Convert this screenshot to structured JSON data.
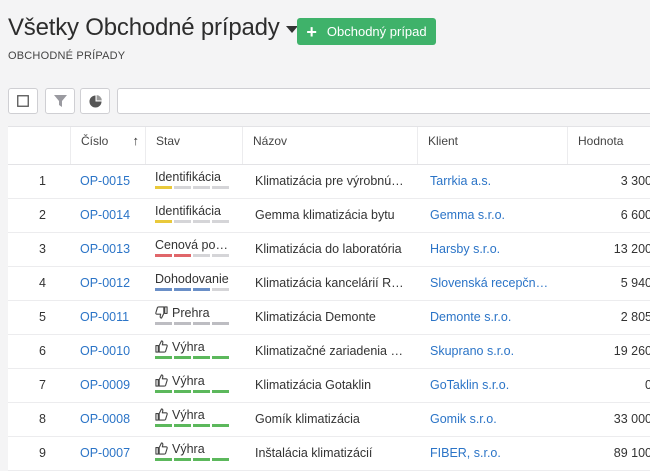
{
  "header": {
    "title": "Všetky Obchodné prípady",
    "subtitle": "OBCHODNÉ PRÍPADY",
    "new_button_label": "Obchodný prípad",
    "new_button_icon": "plus-icon"
  },
  "toolbar": {
    "checkbox_icon": "checkbox-icon",
    "filter_icon": "filter-icon",
    "chart_icon": "pie-chart-icon",
    "search_value": ""
  },
  "table": {
    "columns": [
      "Číslo",
      "Stav",
      "Názov",
      "Klient",
      "Hodnota"
    ],
    "sort_arrow": "↑",
    "rows": [
      {
        "n": "1",
        "id": "OP-0015",
        "stav": "Identifikácia",
        "stage_icon": "",
        "stage_progress": 1,
        "stage_color": "#e9c93b",
        "nazov": "Klimatizácia pre výrobnú halu",
        "klient": "Tarrkia a.s.",
        "hodnota": "3 300"
      },
      {
        "n": "2",
        "id": "OP-0014",
        "stav": "Identifikácia",
        "stage_icon": "",
        "stage_progress": 1,
        "stage_color": "#e9c93b",
        "nazov": "Gemma klimatizácia bytu",
        "klient": "Gemma s.r.o.",
        "hodnota": "6 600"
      },
      {
        "n": "3",
        "id": "OP-0013",
        "stav": "Cenová ponuka",
        "stage_icon": "",
        "stage_progress": 2,
        "stage_color": "#e0666a",
        "nazov": "Klimatizácia do laboratória",
        "klient": "Harsby s.r.o.",
        "hodnota": "13 200"
      },
      {
        "n": "4",
        "id": "OP-0012",
        "stav": "Dohodovanie",
        "stage_icon": "",
        "stage_progress": 3,
        "stage_color": "#6a8fc7",
        "nazov": "Klimatizácia kancelárií Recepčná",
        "klient": "Slovenská recepčná a.s.",
        "hodnota": "5 940"
      },
      {
        "n": "5",
        "id": "OP-0011",
        "stav": "Prehra",
        "stage_icon": "thumbs-down-icon",
        "stage_progress": 4,
        "stage_color": "#bdbdc2",
        "nazov": "Klimatizácia Demonte",
        "klient": "Demonte s.r.o.",
        "hodnota": "2 805"
      },
      {
        "n": "6",
        "id": "OP-0010",
        "stav": "Výhra",
        "stage_icon": "thumbs-up-icon",
        "stage_progress": 4,
        "stage_color": "#5cb85c",
        "nazov": "Klimatizačné zariadenia Skuprano",
        "klient": "Skuprano s.r.o.",
        "hodnota": "19 260"
      },
      {
        "n": "7",
        "id": "OP-0009",
        "stav": "Výhra",
        "stage_icon": "thumbs-up-icon",
        "stage_progress": 4,
        "stage_color": "#5cb85c",
        "nazov": "Klimatizácia Gotaklin",
        "klient": "GoTaklin s.r.o.",
        "hodnota": "0"
      },
      {
        "n": "8",
        "id": "OP-0008",
        "stav": "Výhra",
        "stage_icon": "thumbs-up-icon",
        "stage_progress": 4,
        "stage_color": "#5cb85c",
        "nazov": "Gomík klimatizácia",
        "klient": "Gomik s.r.o.",
        "hodnota": "33 000"
      },
      {
        "n": "9",
        "id": "OP-0007",
        "stav": "Výhra",
        "stage_icon": "thumbs-up-icon",
        "stage_progress": 4,
        "stage_color": "#5cb85c",
        "nazov": "Inštalácia klimatizácií",
        "klient": "FIBER, s.r.o.",
        "hodnota": "89 100"
      }
    ]
  },
  "colors": {
    "accent_green": "#3fb26a",
    "link_blue": "#2b74c7",
    "inactive_segment": "#d5d5d8"
  }
}
